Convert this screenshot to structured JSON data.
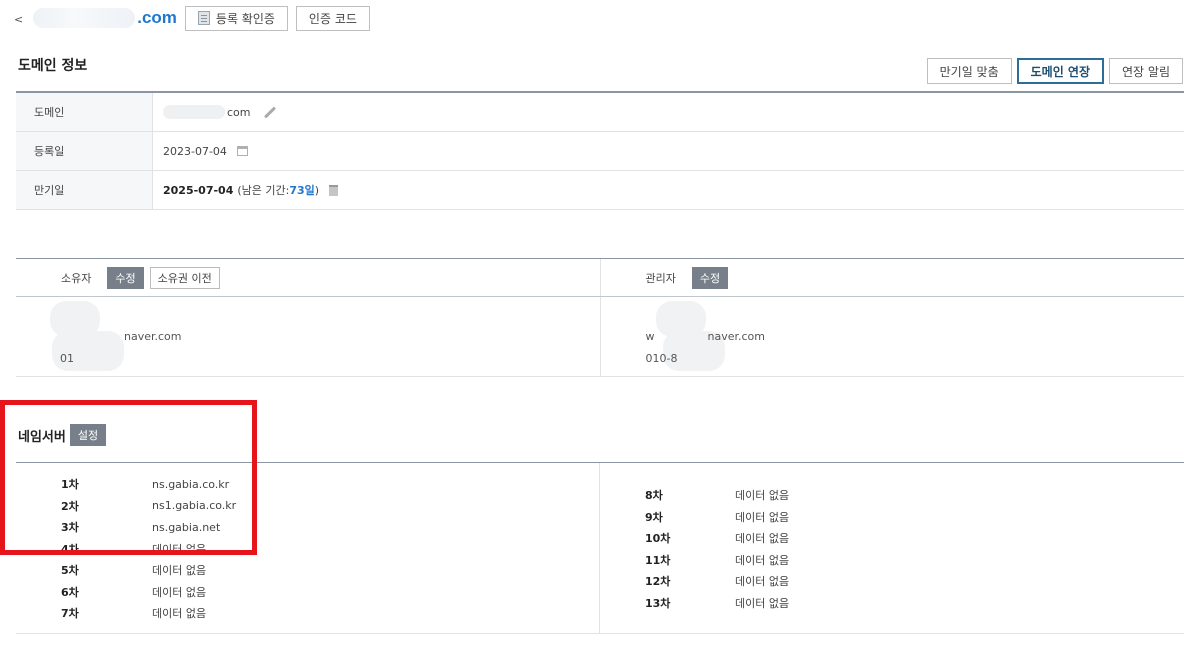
{
  "top": {
    "back": "<",
    "domain_tld": ".com",
    "btn_registration": "등록 확인증",
    "btn_auth_code": "인증 코드"
  },
  "domain_info": {
    "title": "도메인 정보",
    "actions": [
      "만기일 맞춤",
      "도메인 연장",
      "연장 알림"
    ],
    "rows": {
      "domain": {
        "label": "도메인",
        "value": "com"
      },
      "registered": {
        "label": "등록일",
        "value": "2023-07-04"
      },
      "expires": {
        "label": "만기일",
        "value": "2025-07-04",
        "remain_prefix": "(남은 기간: ",
        "remain_days": "73일",
        "remain_suffix": " )"
      }
    }
  },
  "contacts": {
    "owner": {
      "label": "소유자",
      "edit": "수정",
      "transfer": "소유권 이전",
      "email": "naver.com",
      "phone": "01"
    },
    "admin": {
      "label": "관리자",
      "edit": "수정",
      "email_prefix": "w",
      "email": "naver.com",
      "phone": "010-8"
    }
  },
  "nameserver": {
    "title": "네임서버",
    "setting": "설정",
    "left": [
      {
        "idx": "1차",
        "value": "ns.gabia.co.kr"
      },
      {
        "idx": "2차",
        "value": "ns1.gabia.co.kr"
      },
      {
        "idx": "3차",
        "value": "ns.gabia.net"
      },
      {
        "idx": "4차",
        "value": "데이터 없음"
      },
      {
        "idx": "5차",
        "value": "데이터 없음"
      },
      {
        "idx": "6차",
        "value": "데이터 없음"
      },
      {
        "idx": "7차",
        "value": "데이터 없음"
      }
    ],
    "right": [
      {
        "idx": "8차",
        "value": "데이터 없음"
      },
      {
        "idx": "9차",
        "value": "데이터 없음"
      },
      {
        "idx": "10차",
        "value": "데이터 없음"
      },
      {
        "idx": "11차",
        "value": "데이터 없음"
      },
      {
        "idx": "12차",
        "value": "데이터 없음"
      },
      {
        "idx": "13차",
        "value": "데이터 없음"
      }
    ]
  },
  "colors": {
    "accent": "#2277cc",
    "highlight_box": "#e6151c",
    "dark_button": "#77808a",
    "primary_border": "#2d6d97"
  }
}
